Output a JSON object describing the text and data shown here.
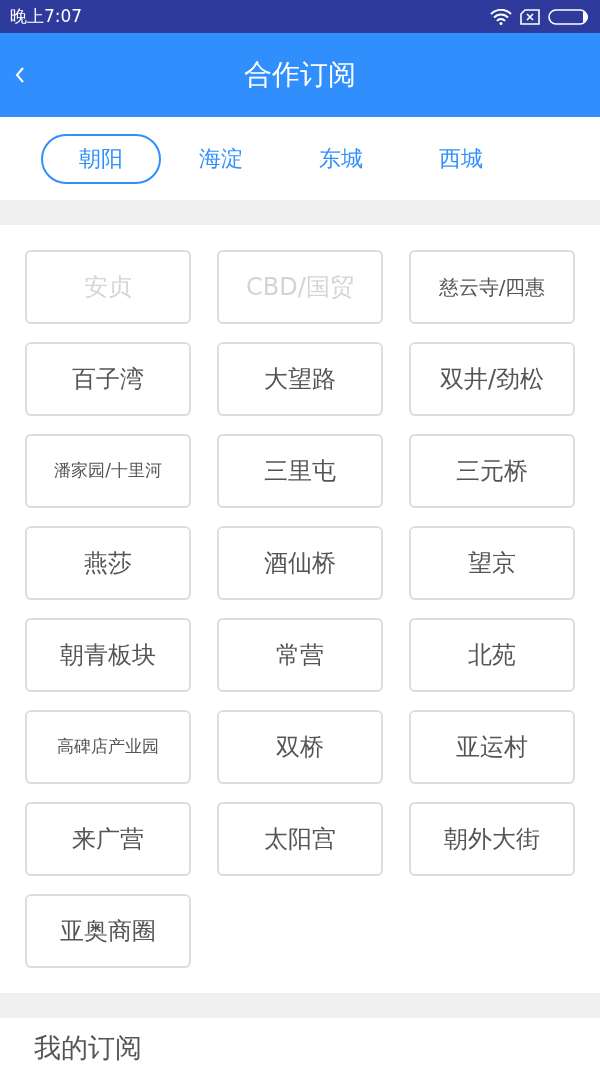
{
  "status_bar": {
    "time": "晚上7:07"
  },
  "header": {
    "title": "合作订阅"
  },
  "tabs": [
    {
      "label": "朝阳",
      "selected": true
    },
    {
      "label": "海淀",
      "selected": false
    },
    {
      "label": "东城",
      "selected": false
    },
    {
      "label": "西城",
      "selected": false
    }
  ],
  "areas": [
    {
      "label": "安贞",
      "disabled": true
    },
    {
      "label": "CBD/国贸",
      "disabled": true
    },
    {
      "label": "慈云寺/四惠",
      "disabled": false
    },
    {
      "label": "百子湾",
      "disabled": false
    },
    {
      "label": "大望路",
      "disabled": false
    },
    {
      "label": "双井/劲松",
      "disabled": false
    },
    {
      "label": "潘家园/十里河",
      "disabled": false
    },
    {
      "label": "三里屯",
      "disabled": false
    },
    {
      "label": "三元桥",
      "disabled": false
    },
    {
      "label": "燕莎",
      "disabled": false
    },
    {
      "label": "酒仙桥",
      "disabled": false
    },
    {
      "label": "望京",
      "disabled": false
    },
    {
      "label": "朝青板块",
      "disabled": false
    },
    {
      "label": "常营",
      "disabled": false
    },
    {
      "label": "北苑",
      "disabled": false
    },
    {
      "label": "高碑店产业园",
      "disabled": false
    },
    {
      "label": "双桥",
      "disabled": false
    },
    {
      "label": "亚运村",
      "disabled": false
    },
    {
      "label": "来广营",
      "disabled": false
    },
    {
      "label": "太阳宫",
      "disabled": false
    },
    {
      "label": "朝外大街",
      "disabled": false
    },
    {
      "label": "亚奥商圈",
      "disabled": false
    }
  ],
  "my_subscriptions": {
    "title": "我的订阅"
  }
}
